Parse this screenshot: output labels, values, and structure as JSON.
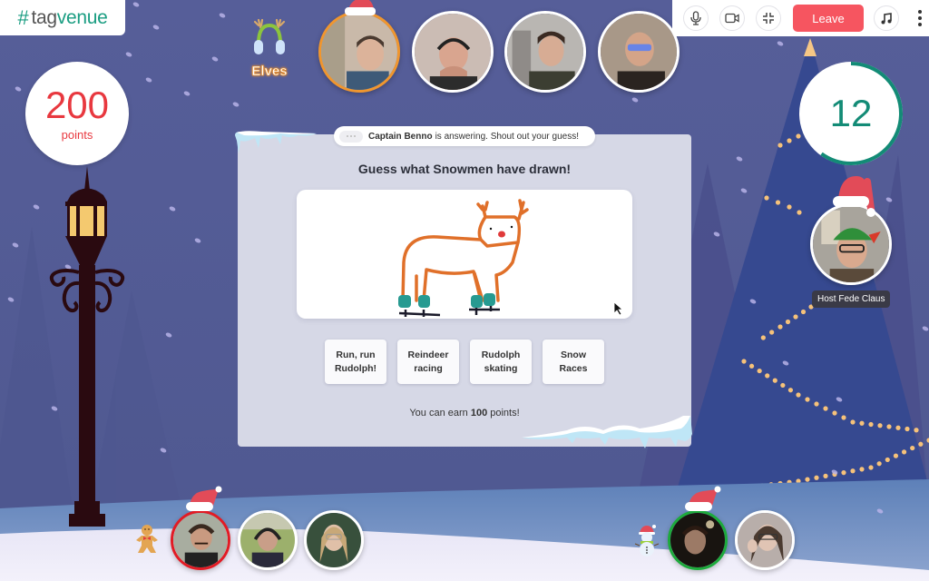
{
  "app": {
    "logo_hash": "#",
    "logo_tag": "tag",
    "logo_venue": "venue"
  },
  "score": {
    "value": "200",
    "label": "points",
    "color": "#e8383f"
  },
  "team": {
    "name": "Elves",
    "icon": "reindeer-earmuffs-icon"
  },
  "top_participants": [
    {
      "name": "participant-1",
      "highlight": "orange",
      "has_hat": true
    },
    {
      "name": "participant-2",
      "highlight": "none",
      "has_hat": false
    },
    {
      "name": "participant-3",
      "highlight": "none",
      "has_hat": false
    },
    {
      "name": "participant-4",
      "highlight": "none",
      "has_hat": false
    }
  ],
  "toolbar": {
    "mic_icon": "microphone-icon",
    "camera_icon": "video-camera-icon",
    "minimize_icon": "exit-fullscreen-icon",
    "leave_label": "Leave",
    "leave_color": "#f65560",
    "music_icon": "music-note-icon",
    "more_icon": "more-vertical-icon"
  },
  "timer": {
    "value": "12",
    "progress": 0.6,
    "color": "#138b76"
  },
  "host": {
    "label": "Host Fede Claus"
  },
  "game": {
    "status_name": "Captain Benno",
    "status_text": "is answering. Shout out your guess!",
    "question": "Guess what Snowmen have drawn!",
    "answers": [
      {
        "line1": "Run, run",
        "line2": "Rudolph!"
      },
      {
        "line1": "Reindeer",
        "line2": "racing"
      },
      {
        "line1": "Rudolph",
        "line2": "skating"
      },
      {
        "line1": "Snow",
        "line2": "Races"
      }
    ],
    "earn_prefix": "You can earn",
    "earn_points": "100",
    "earn_suffix": "points!"
  },
  "bottom_left_team": {
    "icon": "gingerbread-man-icon",
    "participants": [
      {
        "name": "participant-5",
        "highlight": "red",
        "has_hat": true
      },
      {
        "name": "participant-6",
        "highlight": "none",
        "has_hat": false
      },
      {
        "name": "participant-7",
        "highlight": "none",
        "has_hat": false
      }
    ]
  },
  "bottom_right_team": {
    "icon": "snowman-icon",
    "participants": [
      {
        "name": "participant-8",
        "highlight": "green",
        "has_hat": true
      },
      {
        "name": "participant-9",
        "highlight": "none",
        "has_hat": false
      }
    ]
  }
}
